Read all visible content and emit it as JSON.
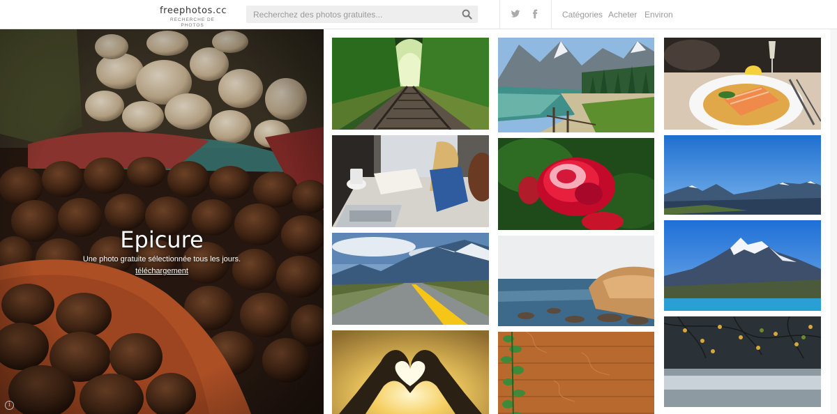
{
  "header": {
    "logo_name": "freephotos.cc",
    "logo_tagline": "RECHERCHE DE PHOTOS",
    "search_placeholder": "Recherchez des photos gratuites...",
    "social": [
      "twitter-icon",
      "facebook-icon"
    ],
    "nav": [
      "Catégories",
      "Acheter",
      "Environ"
    ]
  },
  "hero": {
    "title": "Epicure",
    "subtitle": "Une photo gratuite sélectionnée tous les jours.",
    "download_label": "téléchargement",
    "info_symbol": "i"
  },
  "gallery": {
    "columns": [
      [
        "Voie ferrée en forêt",
        "Bureau avec ordinateur portable",
        "Route de montagne",
        "Cœur avec les mains"
      ],
      [
        "Lac de montagne",
        "Rose rouge",
        "Côte rocheuse",
        "Planches de bois"
      ],
      [
        "Saumon grillé",
        "Montagnes enneigées",
        "Pic de montagne",
        "Branches d'automne"
      ]
    ]
  },
  "colors": {
    "header_text": "#333333",
    "nav_text": "#9a9a9a",
    "search_bg": "#eeeeee",
    "border": "#e3e3e3"
  }
}
